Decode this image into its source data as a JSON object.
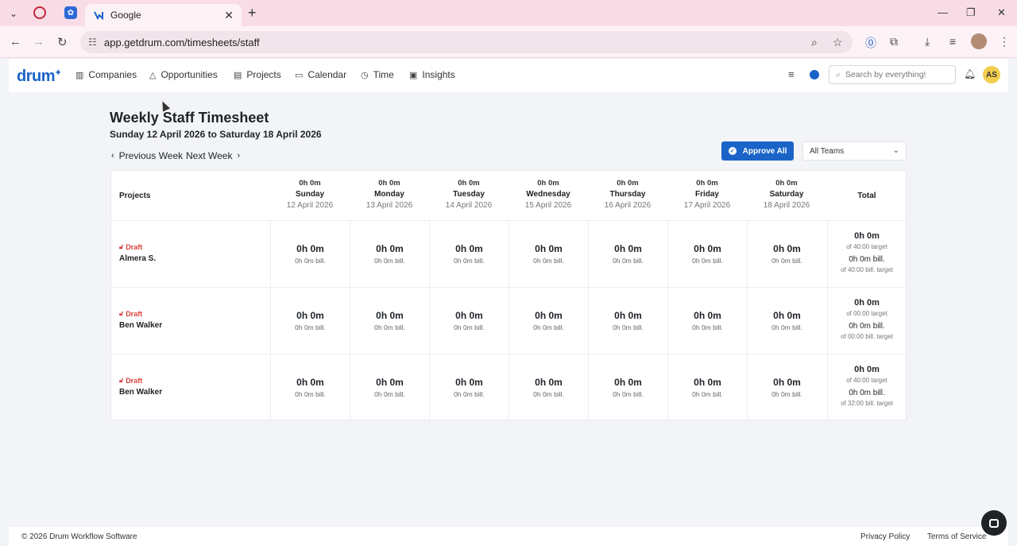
{
  "browser": {
    "tab_title": "Google",
    "url": "app.getdrum.com/timesheets/staff"
  },
  "app": {
    "logo": "drum",
    "nav": [
      "Companies",
      "Opportunities",
      "Projects",
      "Calendar",
      "Time",
      "Insights"
    ],
    "search_placeholder": "Search by everything!",
    "avatar_initials": "AS",
    "accent_color": "#1a64c8"
  },
  "page": {
    "title": "Weekly Staff Timesheet",
    "subtitle": "Sunday 12 April 2026 to Saturday 18 April 2026",
    "prev_week": "Previous Week",
    "next_week": "Next Week",
    "approve_all": "Approve All",
    "team_filter": "All Teams"
  },
  "table": {
    "projects_header": "Projects",
    "total_header": "Total",
    "days": [
      {
        "hours": "0h 0m",
        "name": "Sunday",
        "date": "12 April 2026"
      },
      {
        "hours": "0h 0m",
        "name": "Monday",
        "date": "13 April 2026"
      },
      {
        "hours": "0h 0m",
        "name": "Tuesday",
        "date": "14 April 2026"
      },
      {
        "hours": "0h 0m",
        "name": "Wednesday",
        "date": "15 April 2026"
      },
      {
        "hours": "0h 0m",
        "name": "Thursday",
        "date": "16 April 2026"
      },
      {
        "hours": "0h 0m",
        "name": "Friday",
        "date": "17 April 2026"
      },
      {
        "hours": "0h 0m",
        "name": "Saturday",
        "date": "18 April 2026"
      }
    ],
    "rows": [
      {
        "status": "Draft",
        "name": "Almera S.",
        "cells": [
          {
            "hours": "0h 0m",
            "bill": "0h 0m bill."
          },
          {
            "hours": "0h 0m",
            "bill": "0h 0m bill."
          },
          {
            "hours": "0h 0m",
            "bill": "0h 0m bill."
          },
          {
            "hours": "0h 0m",
            "bill": "0h 0m bill."
          },
          {
            "hours": "0h 0m",
            "bill": "0h 0m bill."
          },
          {
            "hours": "0h 0m",
            "bill": "0h 0m bill."
          },
          {
            "hours": "0h 0m",
            "bill": "0h 0m bill."
          }
        ],
        "total": {
          "hours": "0h 0m",
          "target": "of 40:00 target",
          "bill": "0h 0m bill.",
          "bill_target": "of 40:00 bill. target"
        }
      },
      {
        "status": "Draft",
        "name": "Ben Walker",
        "cells": [
          {
            "hours": "0h 0m",
            "bill": "0h 0m bill."
          },
          {
            "hours": "0h 0m",
            "bill": "0h 0m bill."
          },
          {
            "hours": "0h 0m",
            "bill": "0h 0m bill."
          },
          {
            "hours": "0h 0m",
            "bill": "0h 0m bill."
          },
          {
            "hours": "0h 0m",
            "bill": "0h 0m bill."
          },
          {
            "hours": "0h 0m",
            "bill": "0h 0m bill."
          },
          {
            "hours": "0h 0m",
            "bill": "0h 0m bill."
          }
        ],
        "total": {
          "hours": "0h 0m",
          "target": "of 00:00 target",
          "bill": "0h 0m bill.",
          "bill_target": "of 00:00 bill. target"
        }
      },
      {
        "status": "Draft",
        "name": "Ben Walker",
        "cells": [
          {
            "hours": "0h 0m",
            "bill": "0h 0m bill."
          },
          {
            "hours": "0h 0m",
            "bill": "0h 0m bill."
          },
          {
            "hours": "0h 0m",
            "bill": "0h 0m bill."
          },
          {
            "hours": "0h 0m",
            "bill": "0h 0m bill."
          },
          {
            "hours": "0h 0m",
            "bill": "0h 0m bill."
          },
          {
            "hours": "0h 0m",
            "bill": "0h 0m bill."
          },
          {
            "hours": "0h 0m",
            "bill": "0h 0m bill."
          }
        ],
        "total": {
          "hours": "0h 0m",
          "target": "of 40:00 target",
          "bill": "0h 0m bill.",
          "bill_target": "of 32:00 bill. target"
        }
      }
    ]
  },
  "footer": {
    "copyright": "© 2026 Drum Workflow Software",
    "privacy": "Privacy Policy",
    "terms": "Terms of Service"
  }
}
